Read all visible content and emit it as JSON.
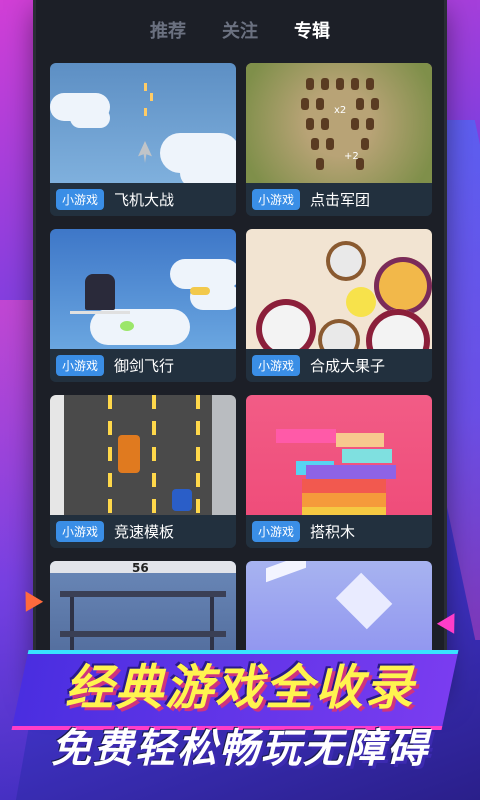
{
  "tabs": [
    {
      "label": "推荐"
    },
    {
      "label": "关注"
    },
    {
      "label": "专辑"
    }
  ],
  "active_tab": "专辑",
  "badge": "小游戏",
  "games": [
    {
      "title": "飞机大战"
    },
    {
      "title": "点击军团"
    },
    {
      "title": "御剑飞行"
    },
    {
      "title": "合成大果子"
    },
    {
      "title": "竞速模板"
    },
    {
      "title": "搭积木"
    }
  ],
  "overlays": {
    "army_counter_1": "x2",
    "army_counter_2": "+2",
    "run_score": "56"
  },
  "banner": {
    "line1": "经典游戏全收录",
    "line2": "免费轻松畅玩无障碍"
  }
}
